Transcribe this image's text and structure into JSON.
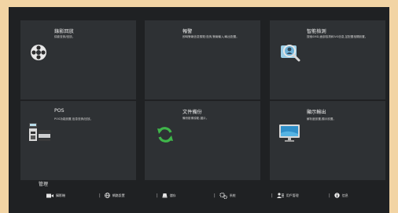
{
  "tiles": [
    {
      "title": "錄影回放",
      "desc": "錄影查詢/回放。",
      "icon": "film-reel-icon"
    },
    {
      "title": "報警",
      "desc": "即時警報信息預覽/查詢,警報輸入/輸出配置。",
      "icon": "none"
    },
    {
      "title": "智能檢測",
      "desc": "搜索SMD,面部檢測和IVS信息,並配置相關設置。",
      "icon": "magnifier-person-icon"
    },
    {
      "title": "POS",
      "desc": "POS功能設置,信息查詢/回放。",
      "icon": "pos-terminal-icon"
    },
    {
      "title": "文件備份",
      "desc": "備份影像錄影,圖片。",
      "icon": "sync-arrows-icon"
    },
    {
      "title": "顯示輸出",
      "desc": "解析度設置,顯示設置。",
      "icon": "monitor-icon"
    }
  ],
  "management": {
    "title": "管理",
    "items": [
      {
        "label": "攝影機",
        "icon": "camera-icon"
      },
      {
        "label": "網路設置",
        "icon": "globe-icon"
      },
      {
        "label": "儲存",
        "icon": "storage-icon"
      },
      {
        "label": "系統",
        "icon": "gears-icon"
      },
      {
        "label": "用戶管理",
        "icon": "users-icon"
      },
      {
        "label": "信息",
        "icon": "info-icon"
      }
    ]
  }
}
